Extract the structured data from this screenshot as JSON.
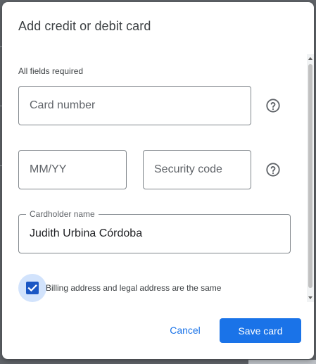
{
  "dialog": {
    "title": "Add credit or debit card",
    "required_note": "All fields required",
    "card_number": {
      "placeholder": "Card number"
    },
    "expiry": {
      "placeholder": "MM/YY"
    },
    "security_code": {
      "placeholder": "Security code"
    },
    "cardholder": {
      "label": "Cardholder name",
      "value": "Judith Urbina Córdoba"
    },
    "billing_same": {
      "label": "Billing address and legal address are the same",
      "checked": true
    },
    "buttons": {
      "cancel": "Cancel",
      "save": "Save card"
    }
  },
  "colors": {
    "accent": "#1a73e8",
    "checkbox": "#1a56c4",
    "checkbox_halo": "#d2e3fc",
    "border": "#80868b"
  },
  "icons": [
    "help-circle-icon",
    "check-icon",
    "scroll-up-arrow-icon",
    "scroll-down-arrow-icon"
  ]
}
